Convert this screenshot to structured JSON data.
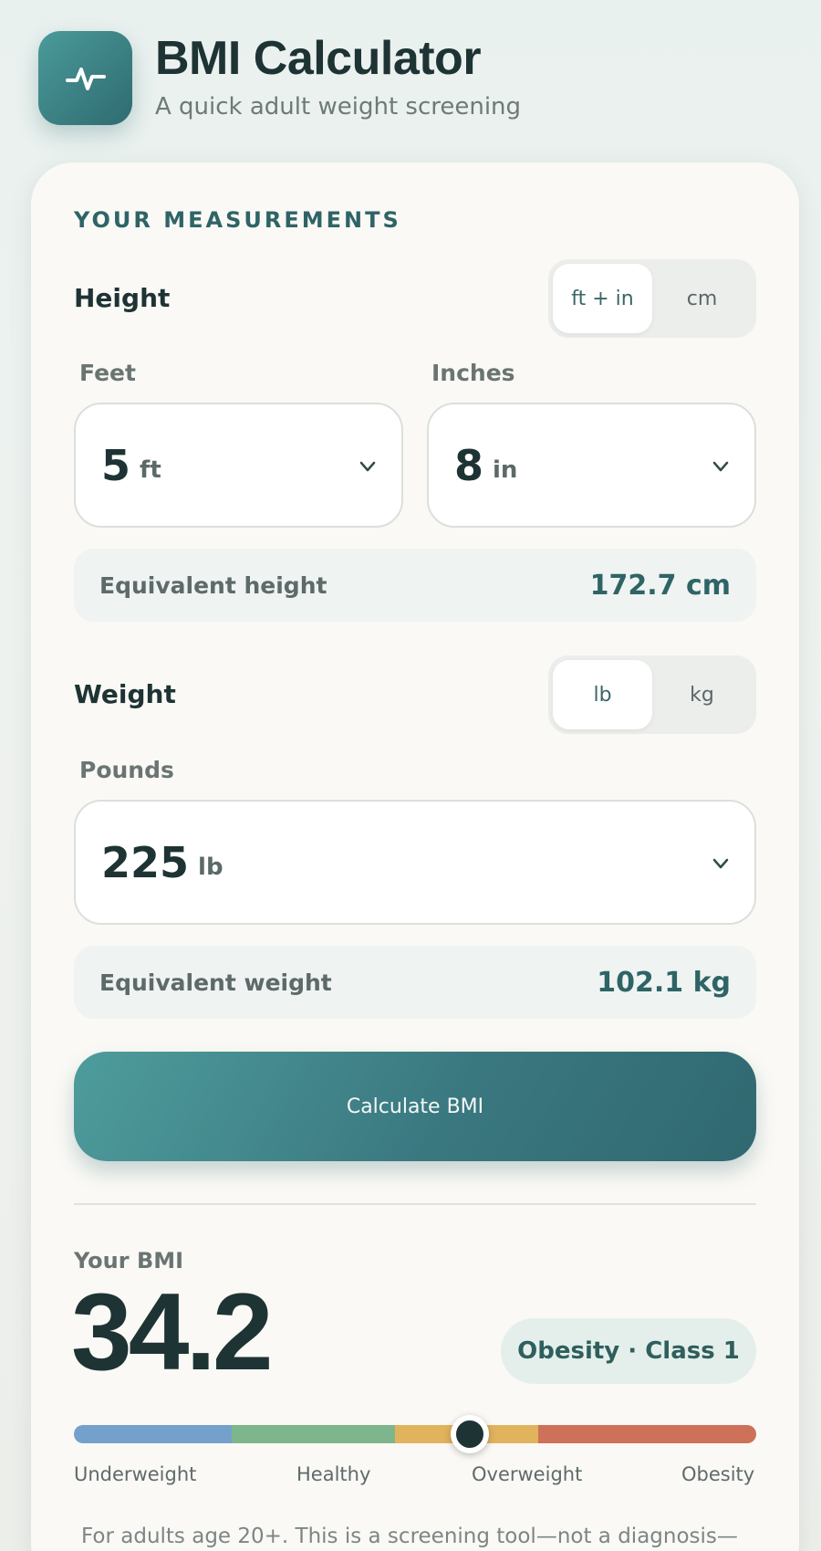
{
  "header": {
    "title": "BMI Calculator",
    "subtitle": "A quick adult weight screening",
    "icon": "pulse-icon"
  },
  "measurements": {
    "section_label": "YOUR MEASUREMENTS",
    "height": {
      "title": "Height",
      "units": [
        "ft + in",
        "cm"
      ],
      "selected_unit": "ft + in",
      "feet_label": "Feet",
      "feet_value": "5",
      "feet_unit": "ft",
      "inches_label": "Inches",
      "inches_value": "8",
      "inches_unit": "in",
      "equiv_label": "Equivalent height",
      "equiv_value": "172.7 cm"
    },
    "weight": {
      "title": "Weight",
      "units": [
        "lb",
        "kg"
      ],
      "selected_unit": "lb",
      "pounds_label": "Pounds",
      "pounds_value": "225",
      "pounds_unit": "lb",
      "equiv_label": "Equivalent weight",
      "equiv_value": "102.1 kg"
    },
    "calculate_label": "Calculate BMI"
  },
  "result": {
    "label": "Your BMI",
    "value": "34.2",
    "category": "Obesity · Class 1",
    "scale": {
      "labels": [
        "Underweight",
        "Healthy",
        "Overweight",
        "Obesity"
      ],
      "colors": [
        "#74a1cc",
        "#7db68c",
        "#e2b35d",
        "#cd7158"
      ],
      "marker_fraction": 0.58
    },
    "note": "For adults age 20+. This is a screening tool—not a diagnosis—"
  }
}
